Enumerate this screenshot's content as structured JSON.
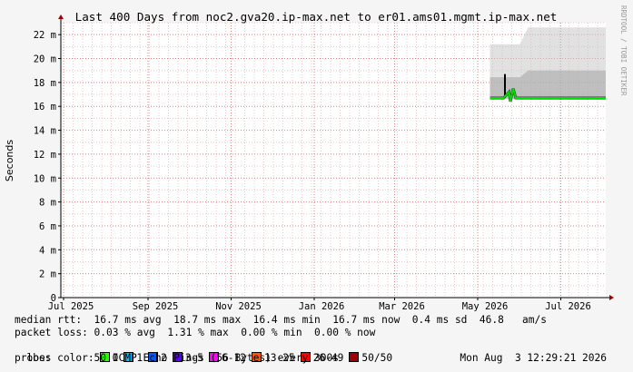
{
  "chart_data": {
    "type": "area",
    "title": "Last 400 Days from noc2.gva20.ip-max.net to er01.ams01.mgmt.ip-max.net",
    "ylabel": "Seconds",
    "xlabel": "",
    "side_label": "RRDTOOL / TOBI OETIKER",
    "ylim": [
      0,
      0.023
    ],
    "y_ticks": [
      {
        "value": 0,
        "label": "0"
      },
      {
        "value": 0.002,
        "label": "2 m"
      },
      {
        "value": 0.004,
        "label": "4 m"
      },
      {
        "value": 0.006,
        "label": "6 m"
      },
      {
        "value": 0.008,
        "label": "8 m"
      },
      {
        "value": 0.01,
        "label": "10 m"
      },
      {
        "value": 0.012,
        "label": "12 m"
      },
      {
        "value": 0.014,
        "label": "14 m"
      },
      {
        "value": 0.016,
        "label": "16 m"
      },
      {
        "value": 0.018,
        "label": "18 m"
      },
      {
        "value": 0.02,
        "label": "20 m"
      },
      {
        "value": 0.022,
        "label": "22 m"
      }
    ],
    "x_range": [
      "2025-06-29",
      "2026-08-03"
    ],
    "x_ticks": [
      {
        "date": "2025-07-01",
        "label": "Jul 2025"
      },
      {
        "date": "2025-09-01",
        "label": "Sep 2025"
      },
      {
        "date": "2025-11-01",
        "label": "Nov 2025"
      },
      {
        "date": "2026-01-01",
        "label": "Jan 2026"
      },
      {
        "date": "2026-03-01",
        "label": "Mar 2026"
      },
      {
        "date": "2026-05-01",
        "label": "May 2026"
      },
      {
        "date": "2026-07-01",
        "label": "Jul 2026"
      }
    ],
    "grid": true,
    "series": [
      {
        "name": "median rtt",
        "color": "#00dd00",
        "points": [
          {
            "x": "2026-05-10",
            "y": 0.0167
          },
          {
            "x": "2026-05-20",
            "y": 0.0167
          },
          {
            "x": "2026-05-24",
            "y": 0.0172
          },
          {
            "x": "2026-05-25",
            "y": 0.0164
          },
          {
            "x": "2026-05-27",
            "y": 0.0175
          },
          {
            "x": "2026-05-29",
            "y": 0.0167
          },
          {
            "x": "2026-06-20",
            "y": 0.0167
          },
          {
            "x": "2026-07-20",
            "y": 0.0167
          },
          {
            "x": "2026-08-03",
            "y": 0.0167
          }
        ]
      }
    ],
    "smoke_range": [
      {
        "x": "2026-05-10",
        "lo": 0.0166,
        "hi": 0.0212
      },
      {
        "x": "2026-06-01",
        "lo": 0.0166,
        "hi": 0.0212
      },
      {
        "x": "2026-06-07",
        "lo": 0.0166,
        "hi": 0.0226
      },
      {
        "x": "2026-08-03",
        "lo": 0.0166,
        "hi": 0.0226
      }
    ],
    "spikes": [
      {
        "x": "2026-05-21",
        "y": 0.0187
      }
    ]
  },
  "colors": {
    "canvas": "#ffffff",
    "frame": "#f5f5f5",
    "grid_minor": "#e8c8c8",
    "grid_major": "#e08080",
    "axis": "#000000",
    "median": "#00dd00",
    "smoke": "#c8c8c8"
  },
  "stats": {
    "median_rtt": "median rtt:  16.7 ms avg  18.7 ms max  16.4 ms min  16.7 ms now  0.4 ms sd  46.8   am/s",
    "packet_loss": "packet loss: 0.03 % avg  1.31 % max  0.00 % min  0.00 % now",
    "loss_color_label": "loss color:",
    "probe": "probe:       50 ICMP Echo Pings (56 Bytes) every 300s",
    "timestamp": "Mon Aug  3 12:29:21 2026"
  },
  "loss_colors": [
    {
      "label": "0",
      "color": "#26ff00"
    },
    {
      "label": "1",
      "color": "#00b8ff"
    },
    {
      "label": "2",
      "color": "#0059ff"
    },
    {
      "label": "3-5",
      "color": "#5e00ff"
    },
    {
      "label": "6-12",
      "color": "#ff00ff"
    },
    {
      "label": "13-25",
      "color": "#ff5500"
    },
    {
      "label": "26-49",
      "color": "#ff0000"
    },
    {
      "label": "50/50",
      "color": "#a10000"
    }
  ]
}
